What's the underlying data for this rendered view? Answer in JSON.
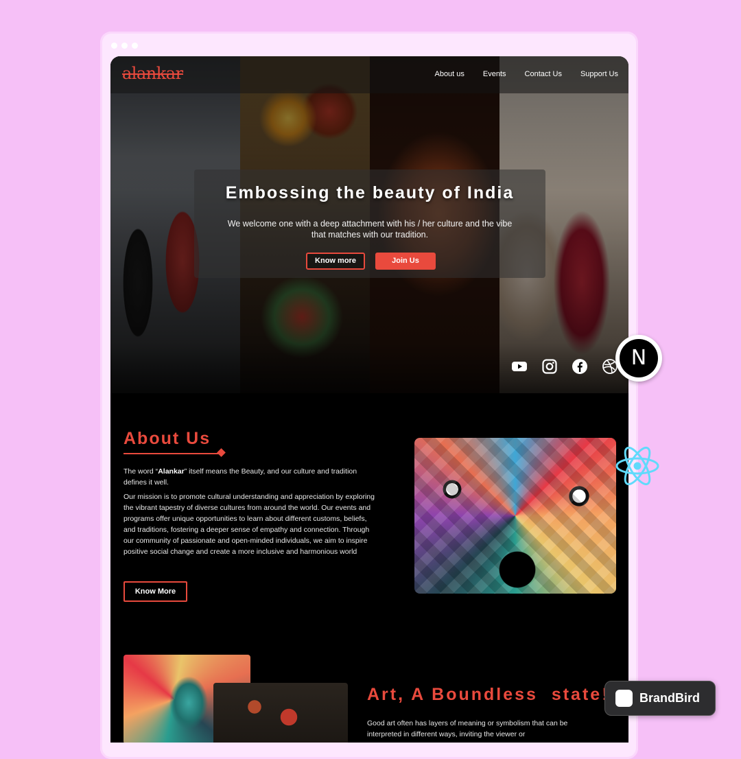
{
  "site": {
    "logo": "alankar",
    "nav": [
      "About us",
      "Events",
      "Contact Us",
      "Support Us"
    ]
  },
  "hero": {
    "title": "Embossing the beauty of India",
    "subtitle": "We welcome one with a deep attachment with his / her culture and the vibe that matches with our tradition.",
    "know_more": "Know more",
    "join_us": "Join Us",
    "socials": [
      "youtube-icon",
      "instagram-icon",
      "facebook-icon",
      "dribbble-icon"
    ]
  },
  "about": {
    "title": "About Us",
    "p1_before": "The word “",
    "p1_strong": "Alankar",
    "p1_after": "” itself means the Beauty, and our culture and tradition defines it well.",
    "p2": "Our mission is to promote cultural understanding and appreciation by exploring the vibrant tapestry of diverse cultures from around the world. Our events and programs offer unique opportunities to learn about different customs, beliefs, and traditions, fostering a deeper sense of empathy and connection. Through our community of passionate and open-minded individuals, we aim to inspire positive social change and create a more inclusive and harmonious world",
    "button": "Know More"
  },
  "art": {
    "title": "Art, A Boundless  state!",
    "text": "Good art often has layers of meaning or symbolism that can be interpreted in different ways, inviting the viewer or"
  },
  "badges": {
    "next_glyph": "N",
    "brandbird": "BrandBird"
  },
  "colors": {
    "background": "#f6c0f7",
    "accent": "#e94a3d",
    "page": "#000000"
  }
}
